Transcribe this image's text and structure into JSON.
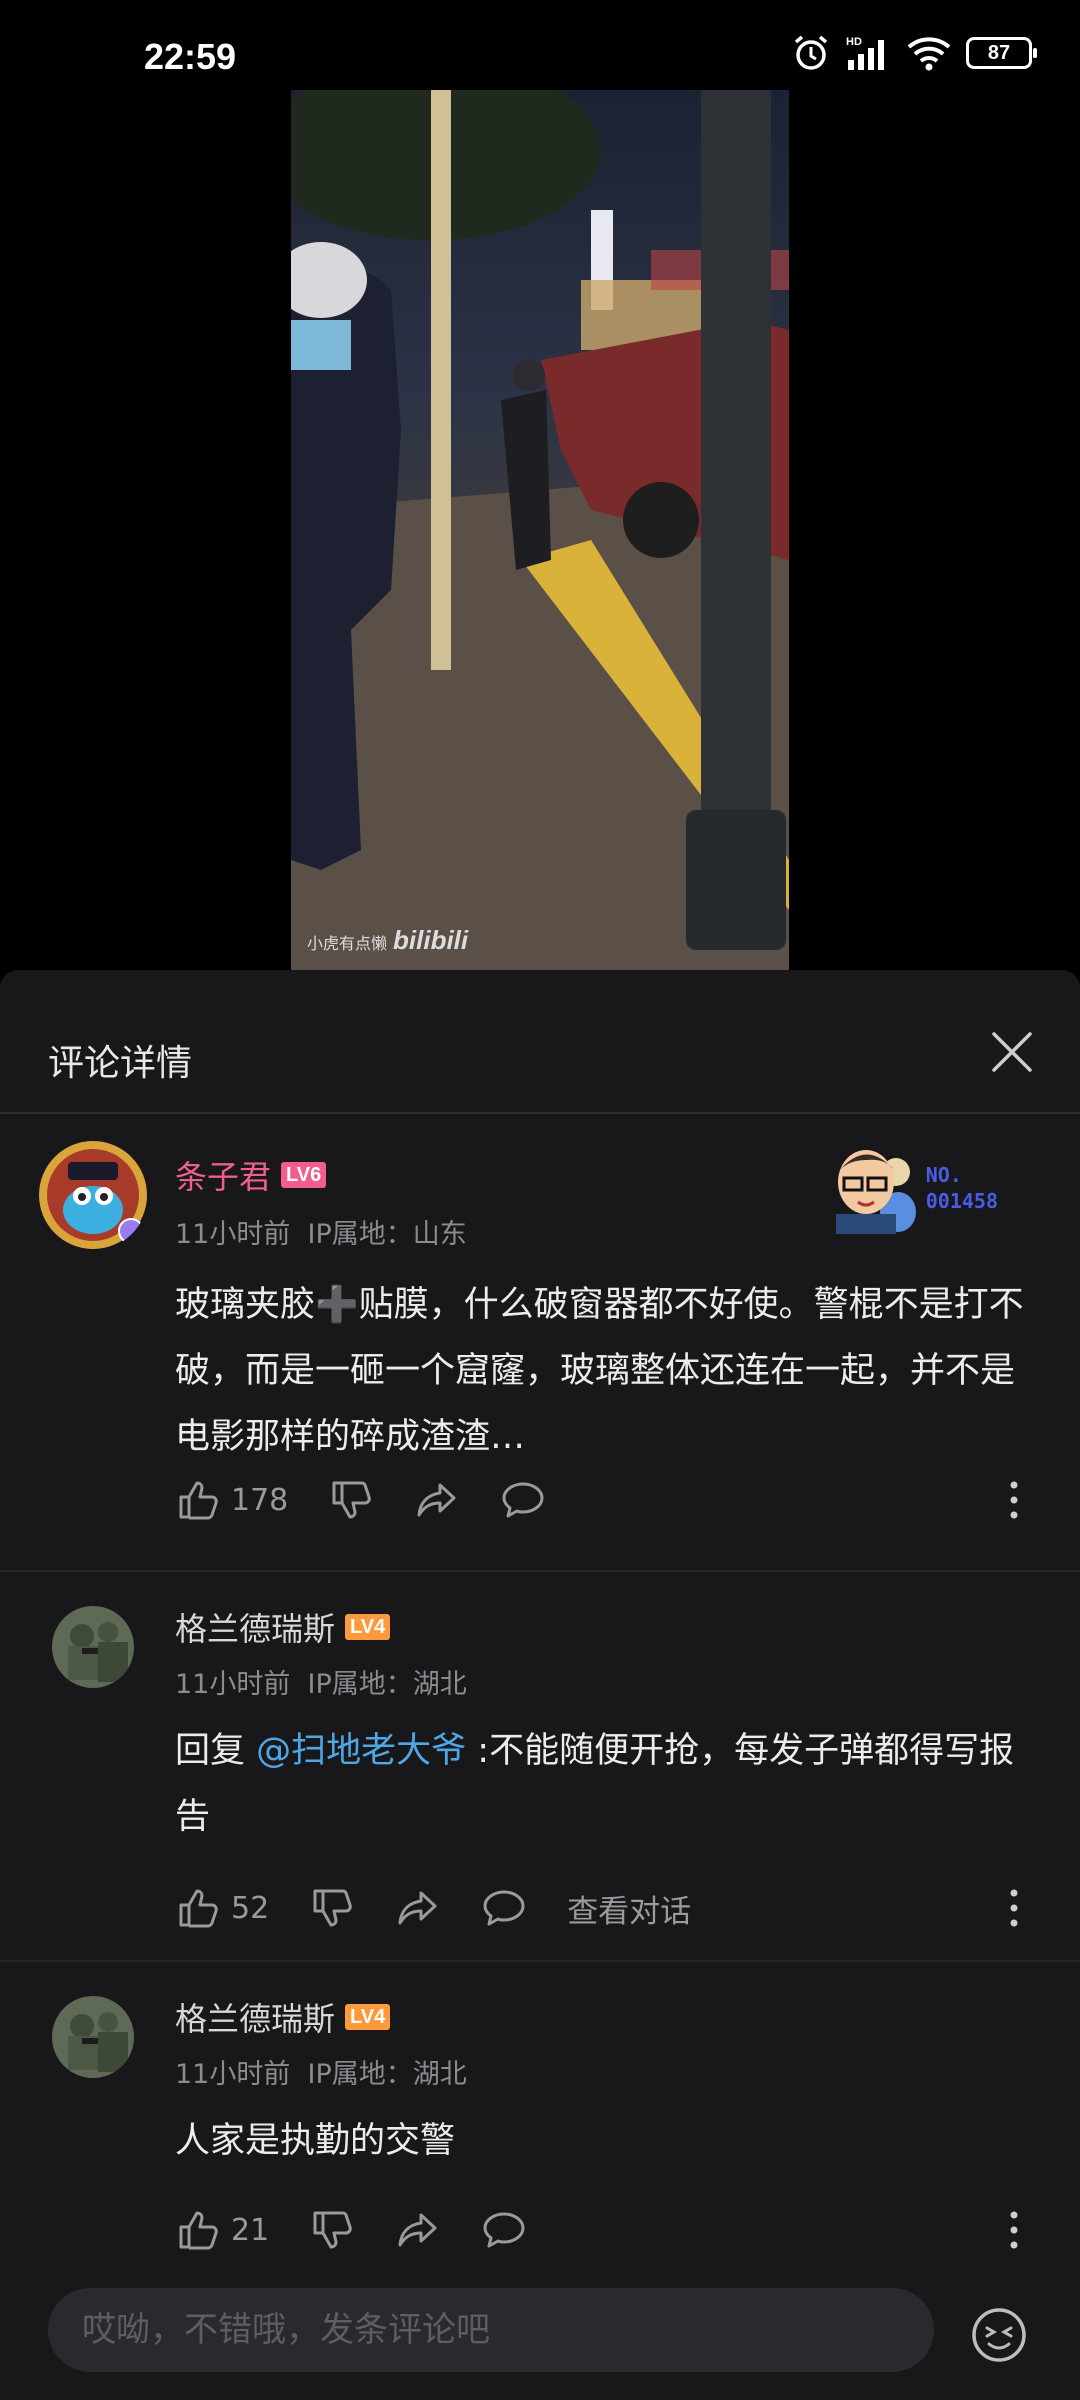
{
  "status_bar": {
    "time": "22:59",
    "battery": "87",
    "network": "HD"
  },
  "video": {
    "watermark_author": "小虎有点懒",
    "watermark_brand": "bilibili"
  },
  "sheet": {
    "title": "评论详情"
  },
  "comments": [
    {
      "username": "条子君",
      "level": "LV6",
      "time": "11小时前",
      "ip": "IP属地：山东",
      "text": "玻璃夹胶➕贴膜，什么破窗器都不好使。警棍不是打不破，而是一砸一个窟窿，玻璃整体还连在一起，并不是电影那样的碎成渣渣…",
      "likes": "178",
      "badge_no_label": "NO.",
      "badge_no_value": "001458"
    },
    {
      "username": "格兰德瑞斯",
      "level": "LV4",
      "time": "11小时前",
      "ip": "IP属地：湖北",
      "reply_prefix": "回复 ",
      "mention": "@扫地老大爷",
      "text": " :不能随便开抢，每发子弹都得写报告",
      "likes": "52",
      "view_conversation": "查看对话"
    },
    {
      "username": "格兰德瑞斯",
      "level": "LV4",
      "time": "11小时前",
      "ip": "IP属地：湖北",
      "text": "人家是执勤的交警",
      "likes": "21"
    }
  ],
  "input": {
    "placeholder": "哎呦，不错哦，发条评论吧"
  },
  "colors": {
    "vip_name": "#ee5f8c",
    "lv6": "#f25d8e",
    "lv4": "#ff9a3c",
    "mention": "#4fa8e6",
    "sheet_bg": "#18181b"
  }
}
